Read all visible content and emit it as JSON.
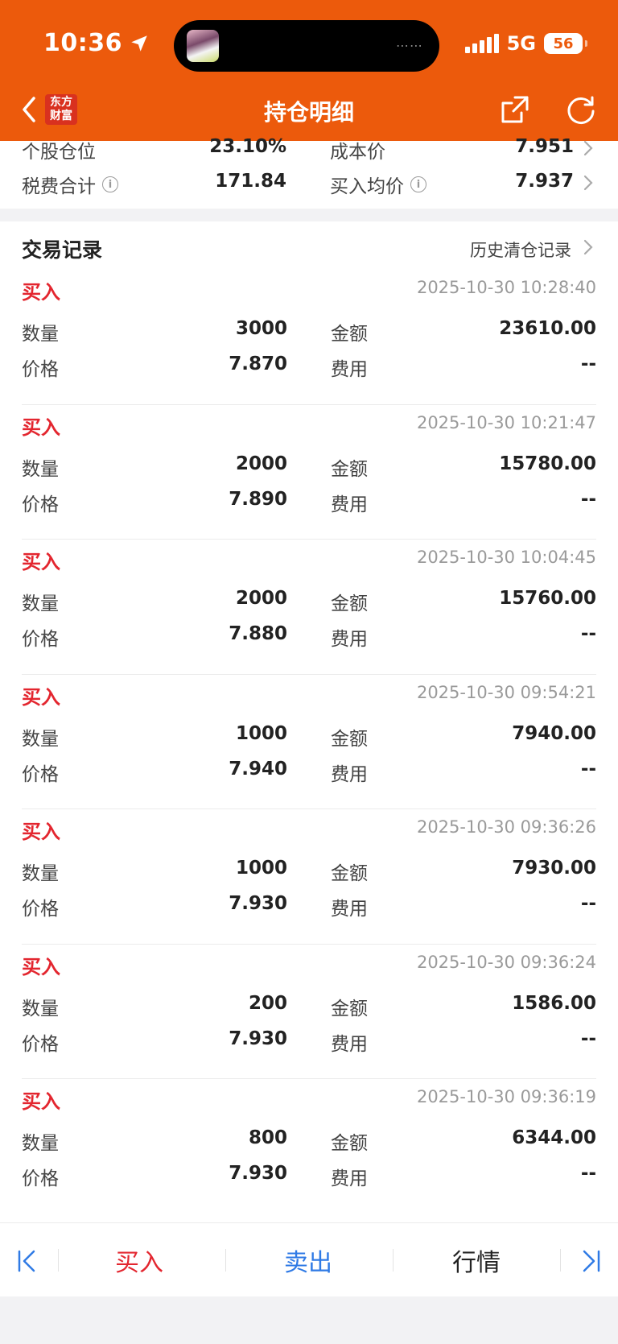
{
  "status_bar": {
    "time": "10:36",
    "network": "5G",
    "battery": "56"
  },
  "nav": {
    "logo_line1": "东方",
    "logo_line2": "财富",
    "title": "持仓明细"
  },
  "summary": {
    "rows": [
      {
        "label": "个股仓位",
        "value": "23.10%",
        "label2": "成本价",
        "value2": "7.951"
      },
      {
        "label": "税费合计",
        "value": "171.84",
        "label2": "买入均价",
        "value2": "7.937"
      }
    ]
  },
  "records": {
    "title": "交易记录",
    "history_link": "历史清仓记录",
    "qty_label": "数量",
    "price_label": "价格",
    "amount_label": "金额",
    "fee_label": "费用",
    "items": [
      {
        "type": "买入",
        "time": "2025-10-30 10:28:40",
        "qty": "3000",
        "price": "7.870",
        "amount": "23610.00",
        "fee": "--"
      },
      {
        "type": "买入",
        "time": "2025-10-30 10:21:47",
        "qty": "2000",
        "price": "7.890",
        "amount": "15780.00",
        "fee": "--"
      },
      {
        "type": "买入",
        "time": "2025-10-30 10:04:45",
        "qty": "2000",
        "price": "7.880",
        "amount": "15760.00",
        "fee": "--"
      },
      {
        "type": "买入",
        "time": "2025-10-30 09:54:21",
        "qty": "1000",
        "price": "7.940",
        "amount": "7940.00",
        "fee": "--"
      },
      {
        "type": "买入",
        "time": "2025-10-30 09:36:26",
        "qty": "1000",
        "price": "7.930",
        "amount": "7930.00",
        "fee": "--"
      },
      {
        "type": "买入",
        "time": "2025-10-30 09:36:24",
        "qty": "200",
        "price": "7.930",
        "amount": "1586.00",
        "fee": "--"
      },
      {
        "type": "买入",
        "time": "2025-10-30 09:36:19",
        "qty": "800",
        "price": "7.930",
        "amount": "6344.00",
        "fee": "--"
      }
    ]
  },
  "bottom_bar": {
    "buy": "买入",
    "sell": "卖出",
    "quote": "行情"
  },
  "colors": {
    "brand": "#ec5a0c",
    "buy_red": "#e3262f",
    "sell_blue": "#2f7ae5"
  }
}
